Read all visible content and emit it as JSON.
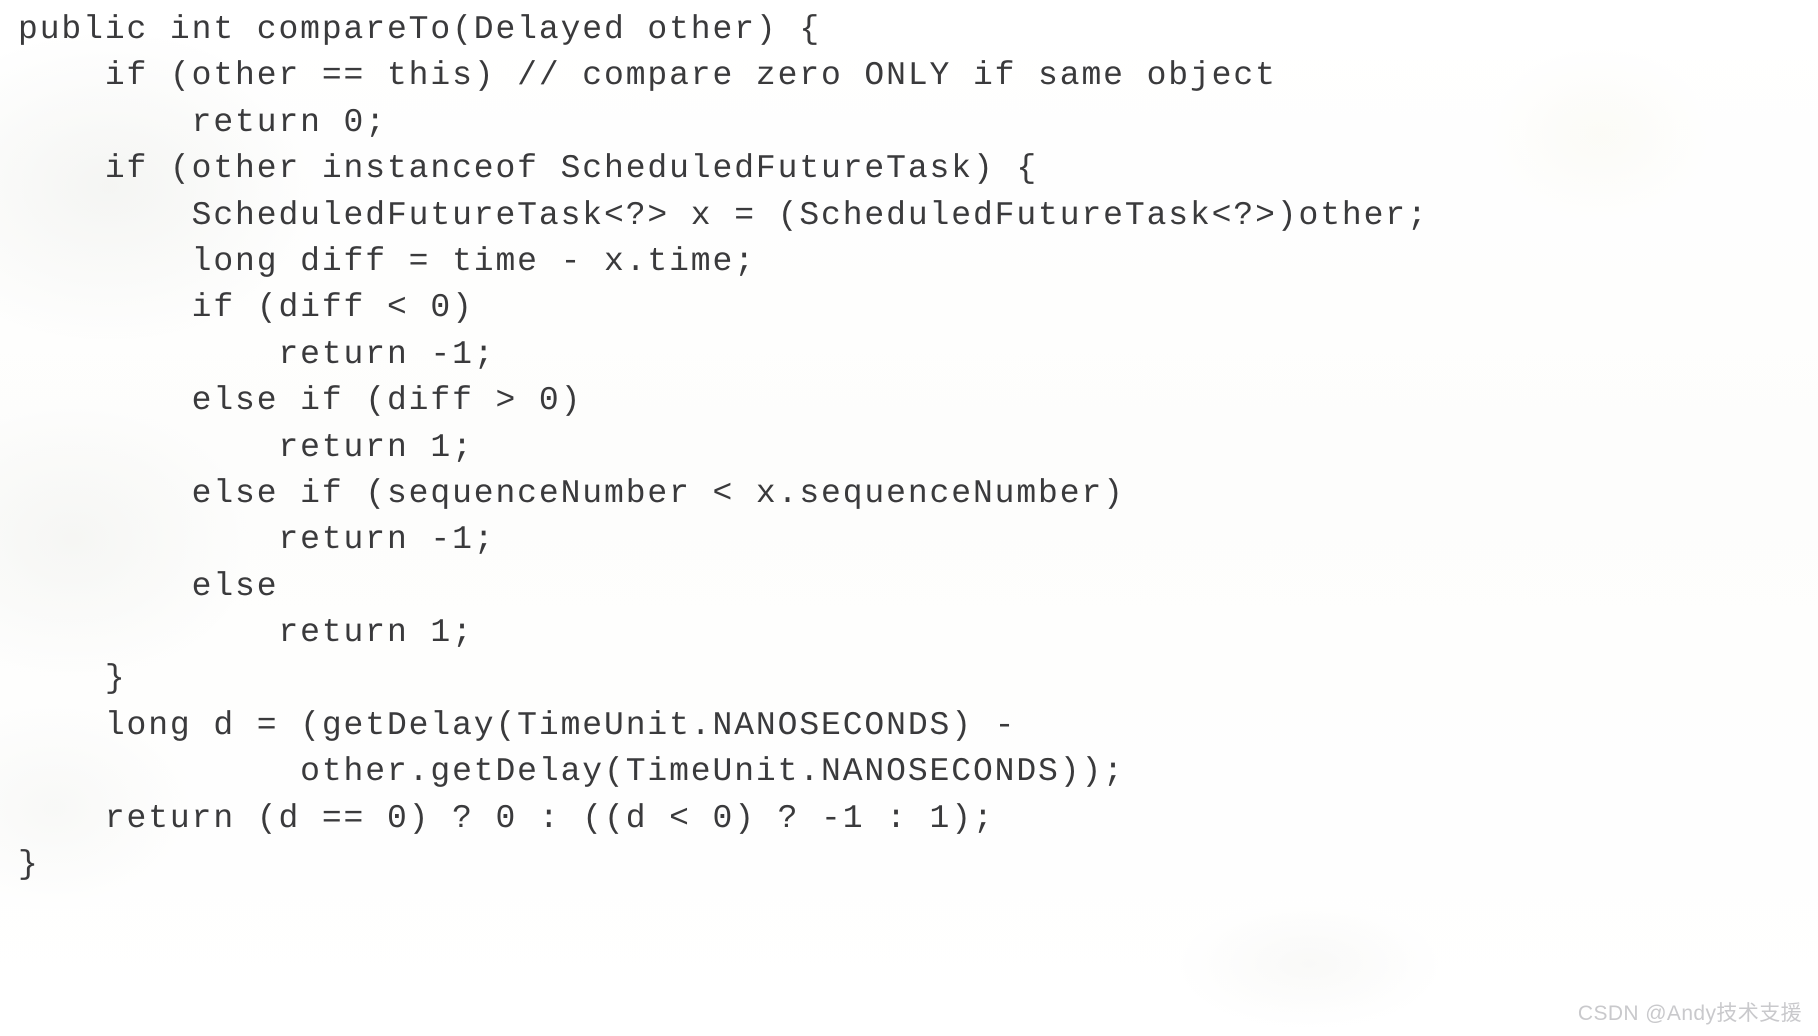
{
  "document": {
    "kind": "scanned-code-listing",
    "language": "Java",
    "background_color": "#fefefe",
    "text_color": "#3a3a3c"
  },
  "code": {
    "lines": [
      "public int compareTo(Delayed other) {",
      "    if (other == this) // compare zero ONLY if same object",
      "        return 0;",
      "    if (other instanceof ScheduledFutureTask) {",
      "        ScheduledFutureTask<?> x = (ScheduledFutureTask<?>)other;",
      "        long diff = time - x.time;",
      "        if (diff < 0)",
      "            return -1;",
      "        else if (diff > 0)",
      "            return 1;",
      "        else if (sequenceNumber < x.sequenceNumber)",
      "            return -1;",
      "        else",
      "            return 1;",
      "    }",
      "    long d = (getDelay(TimeUnit.NANOSECONDS) -",
      "             other.getDelay(TimeUnit.NANOSECONDS));",
      "    return (d == 0) ? 0 : ((d < 0) ? -1 : 1);",
      "}"
    ]
  },
  "watermark": {
    "text": "CSDN @Andy技术支援",
    "color": "#c9c9cc"
  }
}
